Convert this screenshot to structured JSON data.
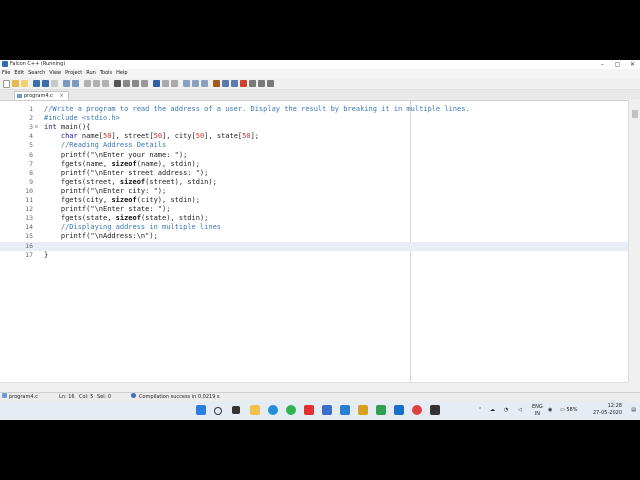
{
  "window": {
    "title": "Falcon C++ (Running)",
    "min": "–",
    "max": "▢",
    "close": "✕"
  },
  "menu": [
    "File",
    "Edit",
    "Search",
    "View",
    "Project",
    "Run",
    "Tools",
    "Help"
  ],
  "tab": {
    "label": "program4.c",
    "close": "×"
  },
  "code_lines": [
    {
      "n": "1",
      "parts": [
        {
          "c": "cm",
          "t": "//Write a program to read the address of a user. Display the result by breaking it in multiple lines."
        }
      ]
    },
    {
      "n": "2",
      "parts": [
        {
          "c": "cm",
          "t": "#include <stdio.h>"
        }
      ]
    },
    {
      "n": "3",
      "fold": "⊟",
      "parts": [
        {
          "c": "kw",
          "t": "int"
        },
        {
          "c": "",
          "t": " main(){"
        }
      ]
    },
    {
      "n": "4",
      "parts": [
        {
          "c": "",
          "t": "    "
        },
        {
          "c": "kw",
          "t": "char"
        },
        {
          "c": "",
          "t": " name["
        },
        {
          "c": "num",
          "t": "50"
        },
        {
          "c": "",
          "t": "], street["
        },
        {
          "c": "num",
          "t": "50"
        },
        {
          "c": "",
          "t": "], city["
        },
        {
          "c": "num",
          "t": "50"
        },
        {
          "c": "",
          "t": "], state["
        },
        {
          "c": "num",
          "t": "50"
        },
        {
          "c": "",
          "t": "];"
        }
      ]
    },
    {
      "n": "5",
      "parts": [
        {
          "c": "",
          "t": "    "
        },
        {
          "c": "cm",
          "t": "//Reading Address Details"
        }
      ]
    },
    {
      "n": "6",
      "parts": [
        {
          "c": "",
          "t": "    printf(\"\\nEnter your name: \");"
        }
      ]
    },
    {
      "n": "7",
      "parts": [
        {
          "c": "",
          "t": "    fgets(name, "
        },
        {
          "c": "bd",
          "t": "sizeof"
        },
        {
          "c": "",
          "t": "(name), stdin);"
        }
      ]
    },
    {
      "n": "8",
      "parts": [
        {
          "c": "",
          "t": "    printf(\"\\nEnter street address: \");"
        }
      ]
    },
    {
      "n": "9",
      "parts": [
        {
          "c": "",
          "t": "    fgets(street, "
        },
        {
          "c": "bd",
          "t": "sizeof"
        },
        {
          "c": "",
          "t": "(street), stdin);"
        }
      ]
    },
    {
      "n": "10",
      "parts": [
        {
          "c": "",
          "t": "    printf(\"\\nEnter city: \");"
        }
      ]
    },
    {
      "n": "11",
      "parts": [
        {
          "c": "",
          "t": "    fgets(city, "
        },
        {
          "c": "bd",
          "t": "sizeof"
        },
        {
          "c": "",
          "t": "(city), stdin);"
        }
      ]
    },
    {
      "n": "12",
      "parts": [
        {
          "c": "",
          "t": "    printf(\"\\nEnter state: \");"
        }
      ]
    },
    {
      "n": "13",
      "parts": [
        {
          "c": "",
          "t": "    fgets(state, "
        },
        {
          "c": "bd",
          "t": "sizeof"
        },
        {
          "c": "",
          "t": "(state), stdin);"
        }
      ]
    },
    {
      "n": "14",
      "parts": [
        {
          "c": "",
          "t": "    "
        },
        {
          "c": "cm",
          "t": "//Displaying address in multiple lines"
        }
      ]
    },
    {
      "n": "15",
      "parts": [
        {
          "c": "",
          "t": "    printf(\"\\nAddress:\\n\");"
        }
      ]
    },
    {
      "n": "16",
      "highlight": true,
      "parts": [
        {
          "c": "",
          "t": ""
        }
      ]
    },
    {
      "n": "17",
      "parts": [
        {
          "c": "",
          "t": "}"
        }
      ]
    }
  ],
  "status": {
    "file": "program4.c",
    "line": "Ln: 16",
    "col": "Col: 5",
    "sel": "Sel: 0",
    "message": "Compilation success in 0.0219 s"
  },
  "tray": {
    "lang": "ENG",
    "region": "IN",
    "battery": "58%",
    "time": "12:28",
    "date": "27-05-2020"
  },
  "colors": {
    "comment": "#3a78b8",
    "keyword": "#1a1a8a",
    "number": "#c03030",
    "current_line": "#e9eef6"
  }
}
